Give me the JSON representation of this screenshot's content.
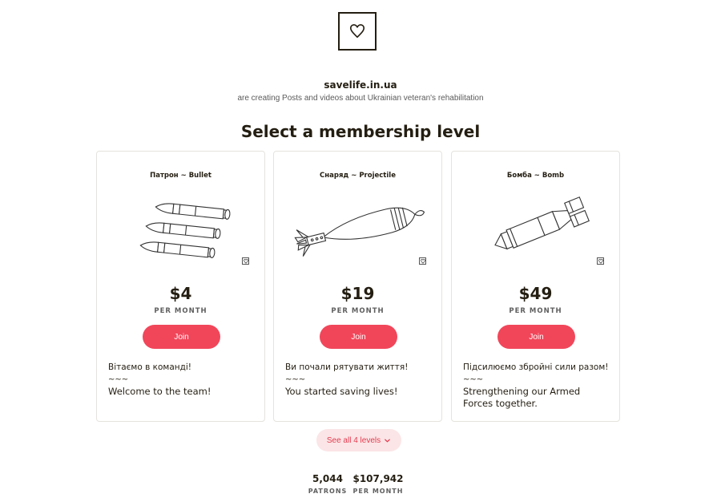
{
  "creator": {
    "name": "savelife.in.ua",
    "description": "are creating Posts and videos about Ukrainian veteran's rehabilitation",
    "logo_icon": "heart-outline-icon"
  },
  "section_title": "Select a membership level",
  "tiers": [
    {
      "name": "Патрон ~ Bullet",
      "illustration": "bullets-illustration",
      "price": "$4",
      "period": "PER MONTH",
      "join_label": "Join",
      "desc_line1": "Вітаємо в команді!",
      "desc_sep": "~~~",
      "desc_line2": "Welcome to the team!"
    },
    {
      "name": "Снаряд ~ Projectile",
      "illustration": "mortar-shell-illustration",
      "price": "$19",
      "period": "PER MONTH",
      "join_label": "Join",
      "desc_line1": "Ви почали рятувати життя!",
      "desc_sep": "~~~",
      "desc_line2": "You started saving lives!"
    },
    {
      "name": "Бомба ~ Bomb",
      "illustration": "aerial-bomb-illustration",
      "price": "$49",
      "period": "PER MONTH",
      "join_label": "Join",
      "desc_line1": "Підсилюємо збройні сили разом!",
      "desc_sep": "~~~",
      "desc_line2": "Strengthening our Armed Forces together."
    }
  ],
  "see_all": {
    "label": "See all 4 levels",
    "icon": "chevron-down-icon"
  },
  "stats": [
    {
      "value": "5,044",
      "label": "PATRONS"
    },
    {
      "value": "$107,942",
      "label": "PER MONTH"
    }
  ],
  "colors": {
    "accent": "#f1465a",
    "accent_soft": "#fbe5e6",
    "text": "#241e12",
    "muted": "#5f5f5f",
    "card_border": "#e5e3dd"
  }
}
